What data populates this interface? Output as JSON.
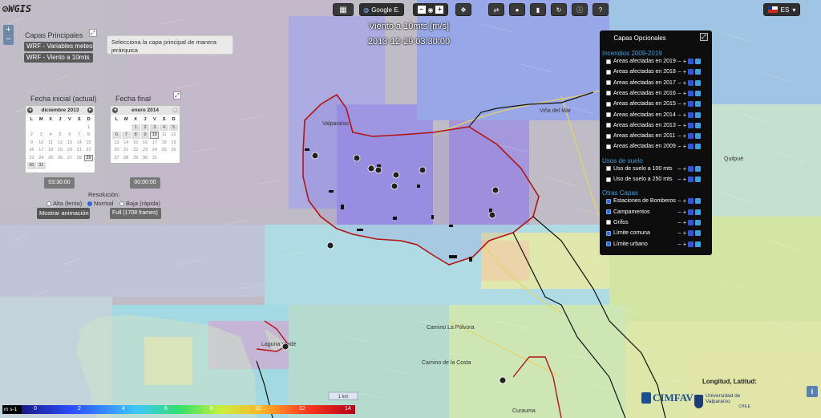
{
  "app": {
    "logo": "WGIS"
  },
  "toolbar": {
    "basemap_label": "Google E.",
    "speed_minus": "−",
    "speed_plus": "+",
    "language": "ES"
  },
  "map_title": {
    "variable": "Viento a 10mts [m/s]",
    "timestamp": "2013-12-29 03:30:00"
  },
  "zoom": {
    "in": "+",
    "out": "−"
  },
  "left_panel": {
    "capas_label": "Capas Principales",
    "layer_select_1": "WRF - Variables meteo",
    "layer_select_2": "WRF - Viento a 10mts",
    "tooltip": "Selecciona la capa principal de manera jerárquica",
    "fecha_inicial_label": "Fecha inicial (actual)",
    "fecha_final_label": "Fecha final",
    "cal1_month": "diciembre 2013",
    "cal2_month": "enero 2014",
    "weekdays": [
      "L",
      "M",
      "X",
      "J",
      "V",
      "S",
      "D"
    ],
    "time1": "03:30:00",
    "time2": "00:00:00",
    "resolucion_label": "Resolución:",
    "res_alta": "Alta (lenta)",
    "res_normal": "Normal",
    "res_baja": "Baja (rápida)",
    "frames_select": "Full (1708 frames)",
    "show_button": "Mostrar animación"
  },
  "optional_layers": {
    "title": "Capas Opcionales",
    "categories": [
      {
        "name": "Incendios 2009-2019",
        "items": [
          {
            "label": "Areas afectadas en 2019",
            "checked": false
          },
          {
            "label": "Areas afectadas en 2018",
            "checked": false
          },
          {
            "label": "Areas afectadas en 2017",
            "checked": false
          },
          {
            "label": "Areas afectadas en 2016",
            "checked": false
          },
          {
            "label": "Areas afectadas en 2015",
            "checked": false
          },
          {
            "label": "Areas afectadas en 2014",
            "checked": false
          },
          {
            "label": "Areas afectadas en 2013",
            "checked": false
          },
          {
            "label": "Areas afectadas en 2011",
            "checked": false
          },
          {
            "label": "Areas afectadas en 2009",
            "checked": false
          }
        ]
      },
      {
        "name": "Usos de suelo",
        "items": [
          {
            "label": "Uso de suelo a 100 mts",
            "checked": false
          },
          {
            "label": "Uso de suelo a 250 mts",
            "checked": false
          }
        ]
      },
      {
        "name": "Otras Capas",
        "items": [
          {
            "label": "Estaciones de Bomberos",
            "checked": true
          },
          {
            "label": "Campamentos",
            "checked": true
          },
          {
            "label": "Grifos",
            "checked": false
          },
          {
            "label": "Límite comuna",
            "checked": true
          },
          {
            "label": "Límite urbano",
            "checked": true
          }
        ]
      }
    ]
  },
  "map_labels": {
    "valparaiso": "Valparaíso",
    "vina": "Viña del Mar",
    "quilpue": "Quilpué",
    "laguna": "Laguna Verde",
    "curauma": "Curauma",
    "camino_costa": "Camino de la Costa",
    "camino_polvora": "Camino La Pólvora",
    "scale": "1 km"
  },
  "legend": {
    "unit": "m s-1",
    "ticks": [
      "0",
      "2",
      "4",
      "6",
      "8",
      "10",
      "12",
      "14"
    ]
  },
  "status": {
    "lonlat": "Longitud, Latitud:"
  },
  "branding": {
    "cimfav": "CIMFAV",
    "uv": "Universidad de Valparaíso",
    "uv_country": "CHILE"
  }
}
